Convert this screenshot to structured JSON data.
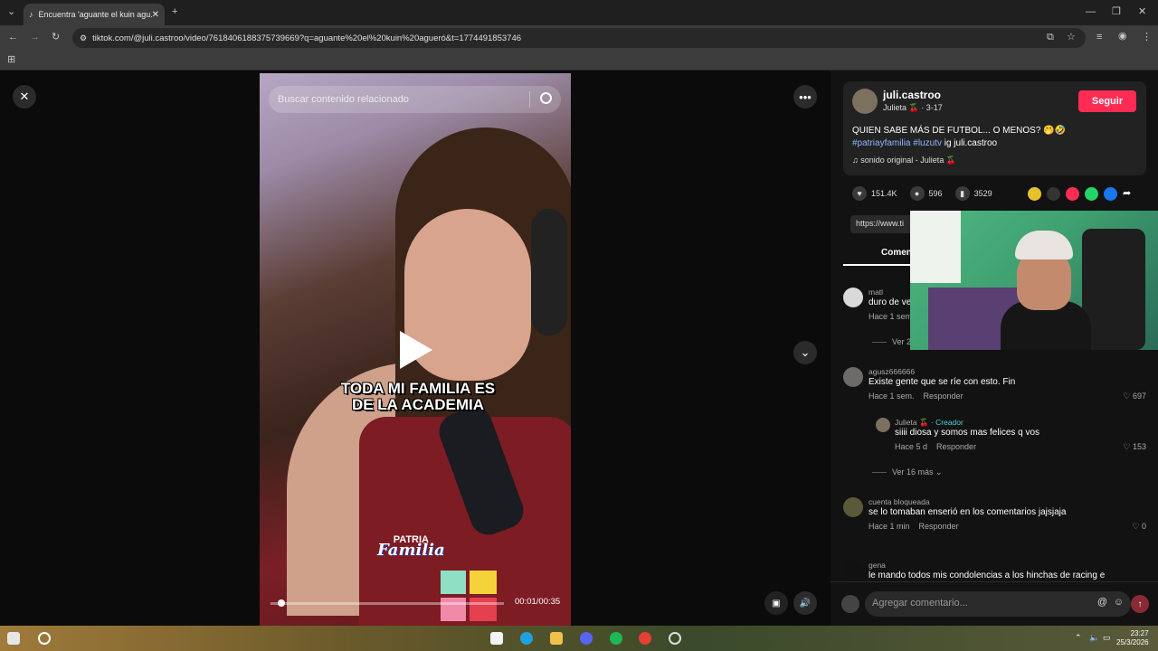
{
  "browser": {
    "tab_title": "Encuentra 'aguante el kuin agu...",
    "url": "tiktok.com/@juli.castroo/video/7618406188375739669?q=aguante%20el%20kuin%20agueró&t=1774491853746"
  },
  "video": {
    "search_placeholder": "Buscar contenido relacionado",
    "caption_line1": "TODA MI FAMILIA ES",
    "caption_line2": "DE LA ACADEMIA",
    "patria": "PATRIA",
    "familia": "Familia",
    "time": "00:01/00:35",
    "progress": 0.03
  },
  "post": {
    "username": "juli.castroo",
    "display_name": "Julieta",
    "date": "3-17",
    "follow_label": "Seguir",
    "description": "QUIEN SABE MÁS DE FUTBOL... O MENOS? 🤭🤣",
    "tag1": "#patriayfamilia",
    "tag2": "#luzutv",
    "ig": "ig juli.castroo",
    "sound": "sonido original - Julieta 🍒",
    "likes": "151.4K",
    "comments": "596",
    "saves": "3529",
    "url_box": "https://www.ti",
    "comments_tab": "Comen"
  },
  "comments": [
    {
      "user": "matl",
      "text": "duro de ve",
      "time": "Hace 1 sem",
      "more": "Ver 2"
    },
    {
      "user": "agusz666666",
      "text": "Existe gente que se ríe con esto. Fin",
      "time": "Hace 1 sem.",
      "reply": "Responder",
      "likes": "697"
    },
    {
      "user": "Julieta",
      "creator": "· Creador",
      "text": "siiii diosa y somos mas felices q vos",
      "time": "Hace 5 d",
      "reply": "Responder",
      "likes": "153"
    },
    {
      "more": "Ver 16 más"
    },
    {
      "user": "cuenta bloqueada",
      "text": "se lo tomaban enserió en los comentarios jajsjaja",
      "time": "Hace 1 min",
      "reply": "Responder",
      "likes": "0"
    },
    {
      "user": "gena",
      "text": "le mando todos mis condolencias a los hinchas de racing e"
    }
  ],
  "add_comment_placeholder": "Agregar comentario...",
  "taskbar": {
    "time": "23:27",
    "date": "25/3/2026"
  }
}
